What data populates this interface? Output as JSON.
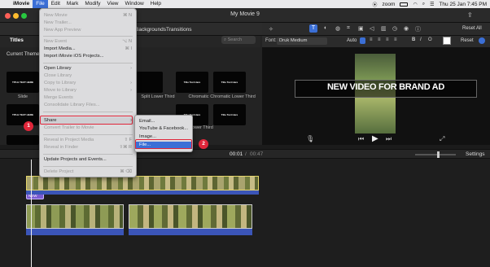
{
  "menubar": {
    "app": "iMovie",
    "items": [
      "File",
      "Edit",
      "Mark",
      "Modify",
      "View",
      "Window",
      "Help"
    ],
    "zoom_label": "zoom",
    "datetime": "Thu 25 Jan  7:45 PM"
  },
  "window": {
    "title": "My Movie 9"
  },
  "browser": {
    "titles_tab": "Titles",
    "tabs": [
      "Backgrounds",
      "Transitions"
    ],
    "search_placeholder": "Search",
    "current_theme": "Current Theme",
    "thumbs": [
      {
        "text": "TITLE TEXT HERE",
        "label": "Slide"
      },
      {
        "text": "",
        "label": "Split Lower Third"
      },
      {
        "text": "Title Text Here",
        "label": ""
      },
      {
        "text": "Title Text Here",
        "label": "Chromatic"
      },
      {
        "text": "TITLE TEXT HERE",
        "label": "Chromatic Lower Third"
      },
      {
        "text": "TITLE TEXT HERE",
        "label": ""
      },
      {
        "text": "Title Text Here",
        "label": "Reveal Lower Third"
      },
      {
        "text": "Title Text Here",
        "label": ""
      },
      {
        "text": "",
        "label": ""
      }
    ]
  },
  "viewer": {
    "font_label": "Font:",
    "font_value": "Druk Medium",
    "auto_label": "Auto",
    "reset_all": "Reset All",
    "reset": "Reset",
    "banner_text": "NEW VIDEO FOR BRAND AD"
  },
  "timeline": {
    "timecode_current": "00:01",
    "timecode_sep": "/",
    "timecode_total": "00:47",
    "settings_label": "Settings",
    "title_clip_label": "NEW"
  },
  "file_menu": {
    "rows": [
      {
        "label": "New Movie",
        "shortcut": "⌘ N",
        "disabled": true
      },
      {
        "label": "New Trailer...",
        "shortcut": "",
        "disabled": true
      },
      {
        "label": "New App Preview",
        "shortcut": "",
        "disabled": true
      },
      {
        "label": "New Event",
        "shortcut": "⌥ N",
        "disabled": true
      },
      {
        "label": "Import Media...",
        "shortcut": "⌘ I",
        "disabled": false
      },
      {
        "label": "Import iMovie iOS Projects...",
        "shortcut": "",
        "disabled": false
      },
      {
        "label": "Open Library",
        "shortcut": "›",
        "disabled": false
      },
      {
        "label": "Close Library",
        "shortcut": "",
        "disabled": true
      },
      {
        "label": "Copy to Library",
        "shortcut": "›",
        "disabled": true
      },
      {
        "label": "Move to Library",
        "shortcut": "›",
        "disabled": true
      },
      {
        "label": "Merge Events",
        "shortcut": "",
        "disabled": true
      },
      {
        "label": "Consolidate Library Files...",
        "shortcut": "",
        "disabled": true
      },
      {
        "label": "Share",
        "shortcut": "›",
        "disabled": false
      },
      {
        "label": "Convert Trailer to Movie",
        "shortcut": "",
        "disabled": true
      },
      {
        "label": "Reveal in Project Media",
        "shortcut": "⇧ F",
        "disabled": true
      },
      {
        "label": "Reveal in Finder",
        "shortcut": "⇧⌘ R",
        "disabled": true
      },
      {
        "label": "Update Projects and Events...",
        "shortcut": "",
        "disabled": false
      },
      {
        "label": "Delete Project",
        "shortcut": "⌘ ⌫",
        "disabled": true
      }
    ]
  },
  "share_menu": {
    "items": [
      "Email...",
      "YouTube & Facebook...",
      "Image...",
      "File..."
    ]
  },
  "annotations": {
    "step1": "1",
    "step2": "2"
  },
  "colors": {
    "accent": "#3b6fd6",
    "highlight": "#e0263a",
    "clip_border": "#e5d66b",
    "audio": "#3b55b8"
  }
}
